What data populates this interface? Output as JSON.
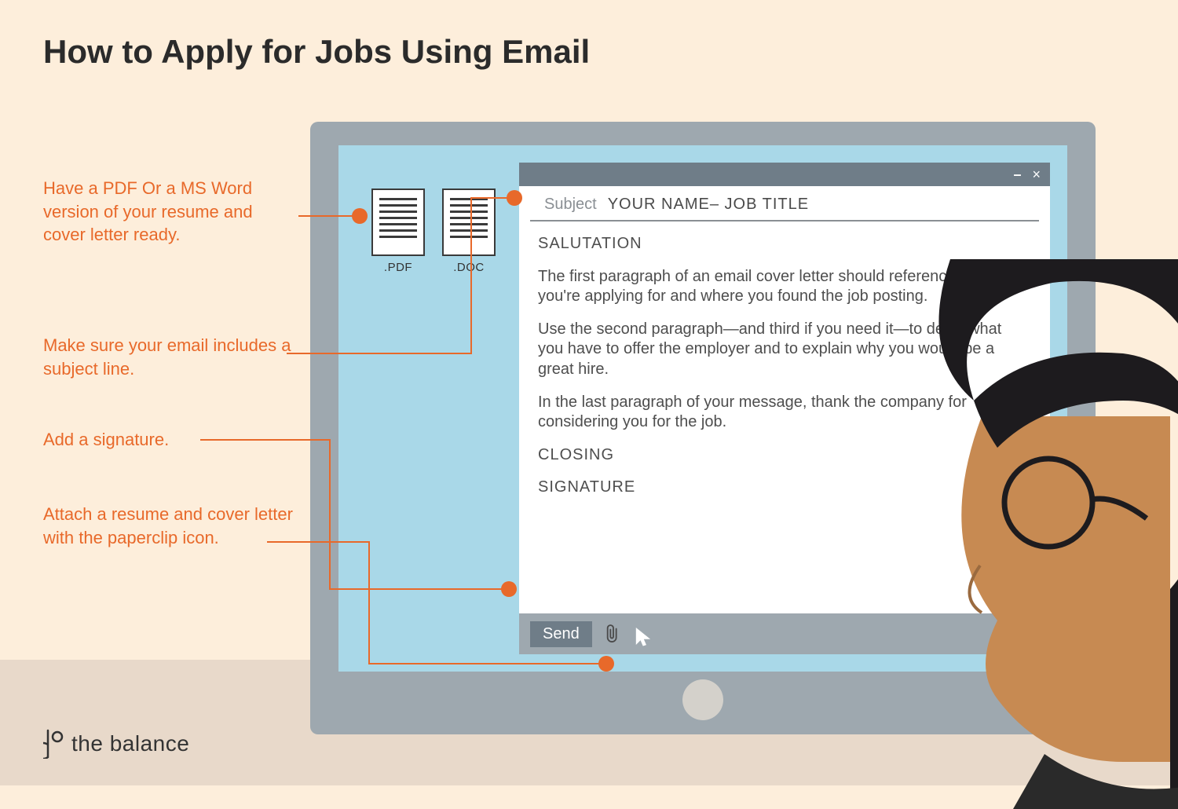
{
  "title": "How to Apply for Jobs Using Email",
  "tips": {
    "t1": "Have a PDF Or a MS Word version of your resume and cover letter ready.",
    "t2": "Make sure your email includes a subject line.",
    "t3": "Add a signature.",
    "t4": "Attach a resume and cover letter with the paperclip icon."
  },
  "files": {
    "pdf": ".PDF",
    "doc": ".DOC"
  },
  "email": {
    "subject_label": "Subject",
    "subject_value": "YOUR NAME– JOB TITLE",
    "salutation": "SALUTATION",
    "p1": "The first paragraph of an email cover letter should reference the job you're applying for and where you found the job posting.",
    "p2": "Use the second paragraph—and third if you need it—to detail what you have to offer the employer and to explain why you would be a great hire.",
    "p3": "In the last paragraph of your message, thank the company for considering you for the job.",
    "closing": "CLOSING",
    "signature": "SIGNATURE",
    "send": "Send",
    "minimize": "–",
    "close": "×"
  },
  "brand": "the balance"
}
